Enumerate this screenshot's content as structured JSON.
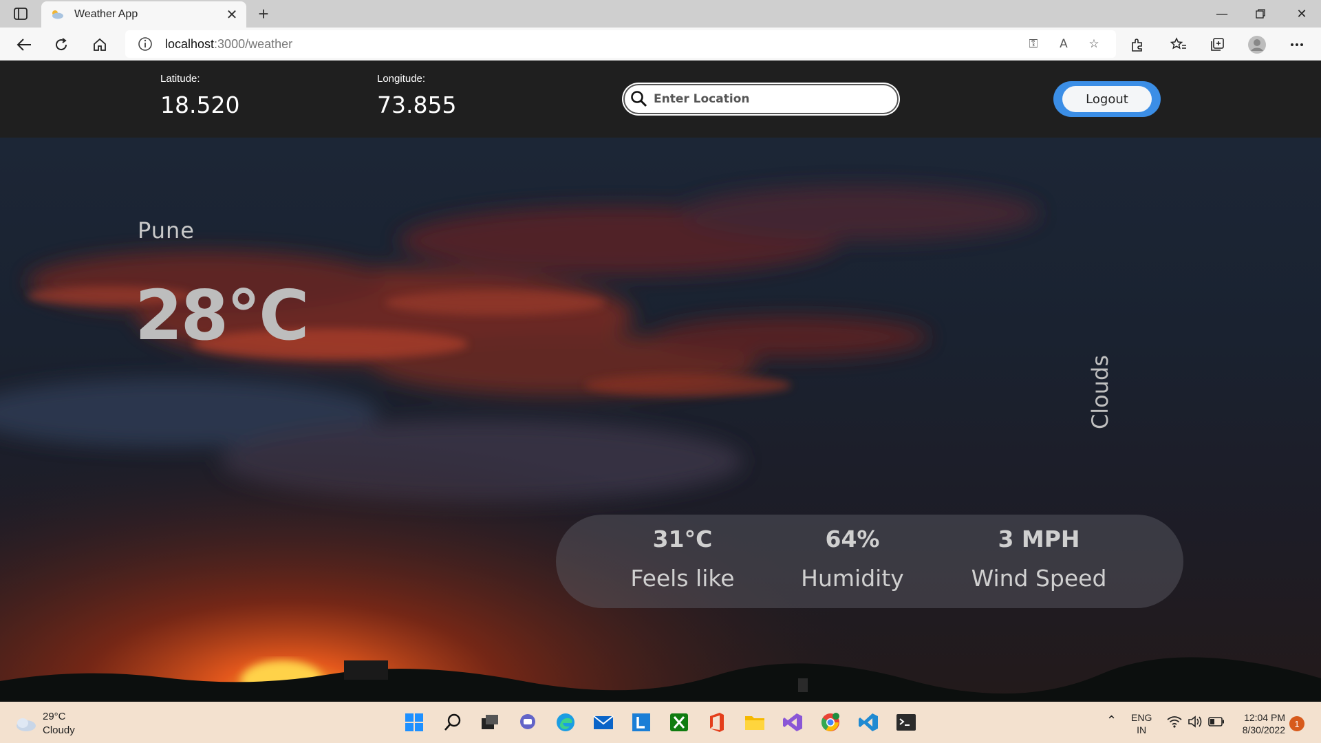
{
  "browser": {
    "tab_title": "Weather App",
    "url_host": "localhost",
    "url_path": ":3000/weather"
  },
  "header": {
    "latitude_label": "Latitude:",
    "latitude_value": "18.520",
    "longitude_label": "Longitude:",
    "longitude_value": "73.855",
    "search_placeholder": "Enter Location",
    "logout_label": "Logout"
  },
  "weather": {
    "city": "Pune",
    "temperature": "28°C",
    "condition": "Clouds",
    "stats": [
      {
        "value": "31°C",
        "label": "Feels like"
      },
      {
        "value": "64%",
        "label": "Humidity"
      },
      {
        "value": "3 MPH",
        "label": "Wind Speed"
      }
    ]
  },
  "taskbar": {
    "weather_temp": "29°C",
    "weather_desc": "Cloudy",
    "language": "ENG",
    "region": "IN",
    "time": "12:04 PM",
    "date": "8/30/2022",
    "notifications": "1",
    "apps": [
      "windows-start-icon",
      "search-icon",
      "task-view-icon",
      "teams-chat-icon",
      "edge-icon",
      "mail-icon",
      "l-app-icon",
      "xbox-icon",
      "office-icon",
      "file-explorer-icon",
      "visual-studio-icon",
      "chrome-icon",
      "vscode-icon",
      "terminal-icon"
    ]
  },
  "colors": {
    "header_bg": "#1f1f1f",
    "logout_ring": "#3b8ee6",
    "taskbar_bg": "#f3e1cf"
  }
}
